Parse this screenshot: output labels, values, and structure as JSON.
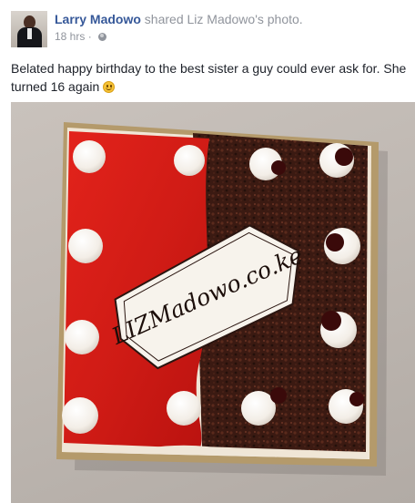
{
  "post": {
    "author": "Larry Madowo",
    "action": "shared Liz Madowo's photo.",
    "time": "18 hrs",
    "separator": "·",
    "message": "Belated happy birthday to the best sister a guy could ever ask for. She turned 16 again",
    "photo": {
      "cake_text": "LIZMadowo.co.ke"
    }
  },
  "icons": {
    "avatar": "profile-photo",
    "audience": "globe-icon",
    "emoticon": "smiley-icon"
  },
  "colors": {
    "author_link": "#365899",
    "meta_text": "#90949c",
    "body_text": "#1d2129"
  }
}
